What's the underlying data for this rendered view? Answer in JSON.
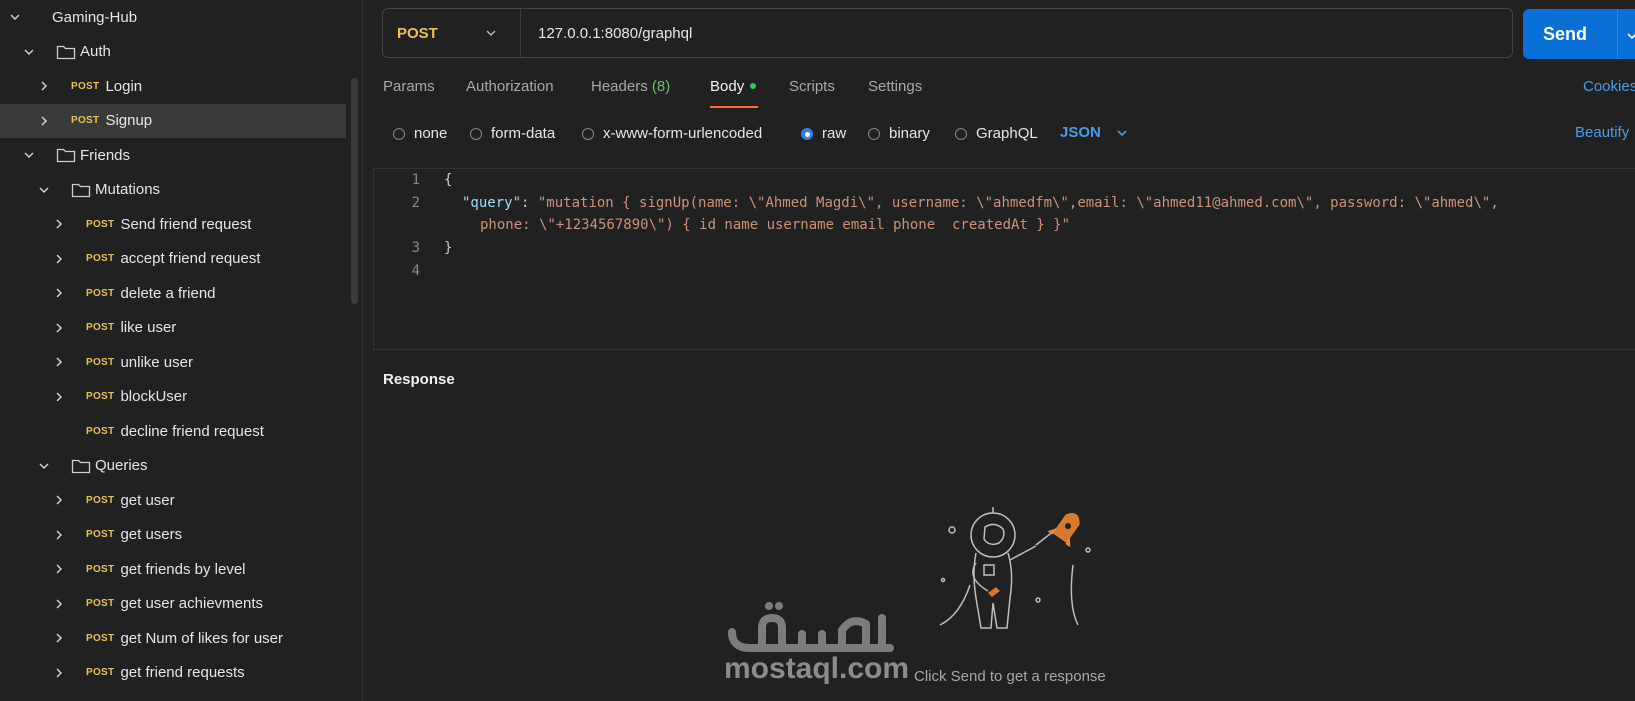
{
  "sidebar": {
    "rows": [
      {
        "kind": "root",
        "label": "Gaming-Hub",
        "expanded": true
      },
      {
        "kind": "folder",
        "label": "Auth",
        "expanded": true
      },
      {
        "kind": "request",
        "method": "POST",
        "label": "Login"
      },
      {
        "kind": "request",
        "method": "POST",
        "label": "Signup",
        "selected": true
      },
      {
        "kind": "folder",
        "label": "Friends",
        "expanded": true
      },
      {
        "kind": "subfolder",
        "label": "Mutations",
        "expanded": true
      },
      {
        "kind": "subrequest",
        "method": "POST",
        "label": "Send friend request"
      },
      {
        "kind": "subrequest",
        "method": "POST",
        "label": "accept friend request"
      },
      {
        "kind": "subrequest",
        "method": "POST",
        "label": "delete a friend"
      },
      {
        "kind": "subrequest",
        "method": "POST",
        "label": "like user"
      },
      {
        "kind": "subrequest",
        "method": "POST",
        "label": "unlike user"
      },
      {
        "kind": "subrequest",
        "method": "POST",
        "label": "blockUser"
      },
      {
        "kind": "subrequest",
        "method": "POST",
        "label": "decline friend request",
        "no_chevron": true
      },
      {
        "kind": "subfolder",
        "label": "Queries",
        "expanded": true
      },
      {
        "kind": "subrequest",
        "method": "POST",
        "label": "get user"
      },
      {
        "kind": "subrequest",
        "method": "POST",
        "label": "get users"
      },
      {
        "kind": "subrequest",
        "method": "POST",
        "label": "get friends by level"
      },
      {
        "kind": "subrequest",
        "method": "POST",
        "label": "get user achievments"
      },
      {
        "kind": "subrequest",
        "method": "POST",
        "label": "get Num of likes for user"
      },
      {
        "kind": "subrequest",
        "method": "POST",
        "label": "get friend requests"
      }
    ]
  },
  "request": {
    "method": "POST",
    "url": "127.0.0.1:8080/graphql",
    "send_label": "Send"
  },
  "tabs": {
    "params": "Params",
    "authorization": "Authorization",
    "headers": "Headers",
    "headers_count": "(8)",
    "body": "Body",
    "scripts": "Scripts",
    "settings": "Settings",
    "cookies": "Cookies"
  },
  "body_options": {
    "none": "none",
    "form_data": "form-data",
    "urlencoded": "x-www-form-urlencoded",
    "raw": "raw",
    "binary": "binary",
    "graphql": "GraphQL",
    "format": "JSON",
    "beautify": "Beautify",
    "selected": "raw"
  },
  "editor": {
    "lines": [
      "1",
      "2",
      "3",
      "4"
    ],
    "line1": "{",
    "key": "\"query\"",
    "colon": ": ",
    "value_part1": "\"mutation { signUp(name: \\\"Ahmed Magdi\\\", username: \\\"ahmedfm\\\",email: \\\"ahmed11@ahmed.com\\\", password: \\\"ahmed\\\",",
    "value_part2": "phone: \\\"+1234567890\\\") { id name username email phone  createdAt } }\"",
    "line3": "}"
  },
  "response": {
    "title": "Response",
    "empty_message": "Click Send to get a response"
  },
  "watermark": {
    "arabic": "مستقل",
    "latin": "mostaql.com"
  },
  "colors": {
    "accent_blue": "#0a6fd7",
    "method_post": "#e8c254",
    "tab_indicator": "#ff6c37",
    "status_dot": "#34c759",
    "link_blue": "#4a9be8"
  }
}
